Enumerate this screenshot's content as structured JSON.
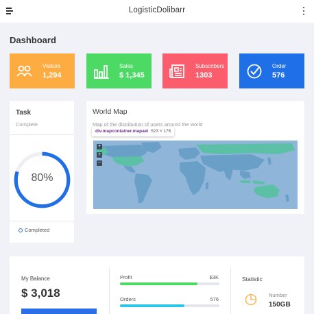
{
  "app": {
    "title": "LogisticDolibarr"
  },
  "page": {
    "title": "Dashboard"
  },
  "stats": [
    {
      "label": "Visitors",
      "value": "1,294",
      "color": "#fdac41",
      "icon": "users-icon"
    },
    {
      "label": "Sales",
      "value": "$ 1,345",
      "color": "#4cd964",
      "icon": "bar-chart-icon"
    },
    {
      "label": "Subscribers",
      "value": "1303",
      "color": "#fc5d6d",
      "icon": "newspaper-icon"
    },
    {
      "label": "Order",
      "value": "576",
      "color": "#1f6fe6",
      "icon": "check-circle-icon"
    }
  ],
  "task": {
    "title": "Task",
    "subtitle": "Complete",
    "percent_text": "80%",
    "percent_value": 80,
    "legend": "Completed",
    "color": "#1f6fe6"
  },
  "map": {
    "title": "World Map",
    "subtitle": "Map of the distribution of users around the world",
    "inspector_selector": "div.mapcontainer.mapael",
    "inspector_size": "523 × 176",
    "zoom_in": "+",
    "zoom_out": "−",
    "ocean_color": "#8fb5d9",
    "land_color": "#6aa0c8",
    "highlight_color": "#5cc0a6"
  },
  "balance": {
    "label": "My Balance",
    "value": "$ 3,018"
  },
  "progress": [
    {
      "label": "Profit",
      "value": "$3K",
      "fill": 0.78,
      "color": "#4cd964"
    },
    {
      "label": "Orders",
      "value": "576",
      "fill": 0.65,
      "color": "#29c7e8"
    }
  ],
  "statistic": {
    "title": "Statistic",
    "number_label": "Number",
    "number_value": "150GB",
    "icon": "pie-chart-icon",
    "icon_color": "#fdac41"
  }
}
